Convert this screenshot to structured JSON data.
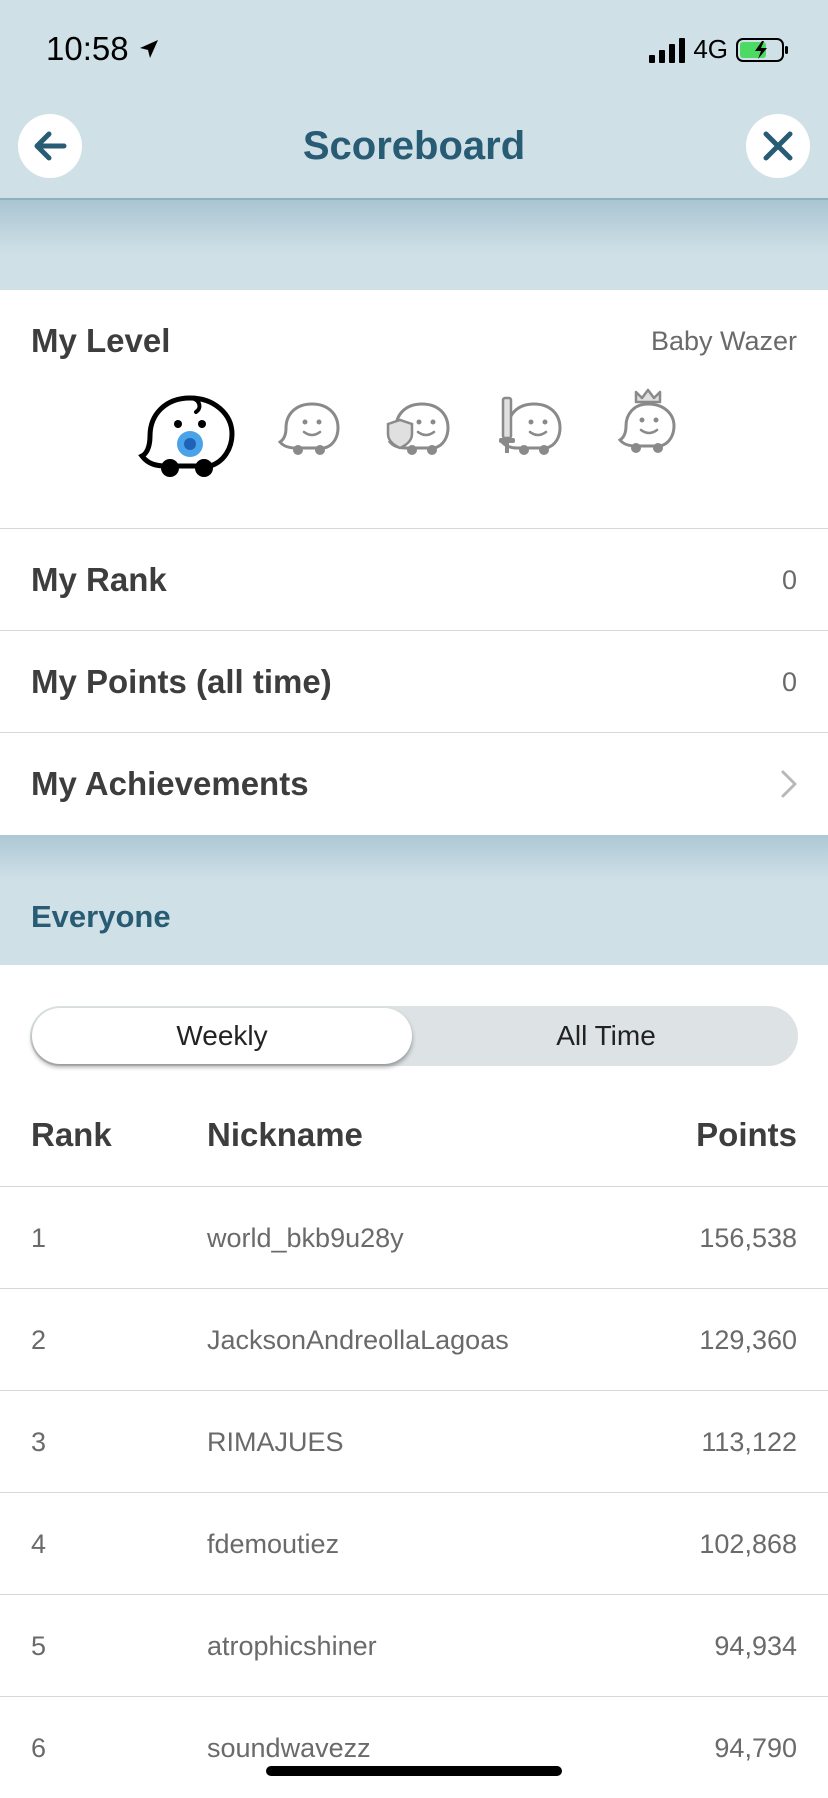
{
  "status_bar": {
    "time": "10:58",
    "network": "4G"
  },
  "header": {
    "title": "Scoreboard"
  },
  "my_level": {
    "label": "My Level",
    "value": "Baby Wazer",
    "levels": [
      "baby-wazer-icon",
      "wazer-icon",
      "shield-wazer-icon",
      "knight-wazer-icon",
      "royalty-wazer-icon"
    ],
    "current_level_index": 0
  },
  "my_rank": {
    "label": "My Rank",
    "value": "0"
  },
  "my_points": {
    "label": "My Points (all time)",
    "value": "0"
  },
  "my_achievements": {
    "label": "My Achievements"
  },
  "everyone": {
    "label": "Everyone"
  },
  "toggle": {
    "weekly": "Weekly",
    "all_time": "All Time",
    "selected": "Weekly"
  },
  "table": {
    "headers": {
      "rank": "Rank",
      "nickname": "Nickname",
      "points": "Points"
    },
    "rows": [
      {
        "rank": "1",
        "nickname": "world_bkb9u28y",
        "points": "156,538"
      },
      {
        "rank": "2",
        "nickname": "JacksonAndreollaLagoas",
        "points": "129,360"
      },
      {
        "rank": "3",
        "nickname": "RIMAJUES",
        "points": "113,122"
      },
      {
        "rank": "4",
        "nickname": "fdemoutiez",
        "points": "102,868"
      },
      {
        "rank": "5",
        "nickname": "atrophicshiner",
        "points": "94,934"
      },
      {
        "rank": "6",
        "nickname": "soundwavezz",
        "points": "94,790"
      }
    ]
  },
  "colors": {
    "header_bg": "#d0e0e7",
    "title": "#285b74",
    "accent_blue": "#4aa3e8"
  }
}
